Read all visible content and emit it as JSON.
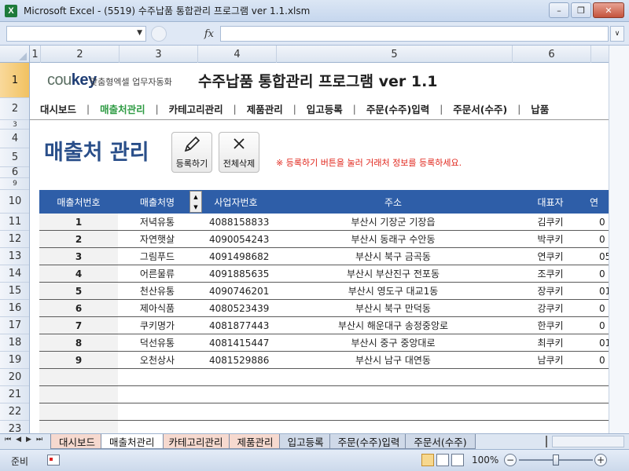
{
  "window": {
    "title": "Microsoft Excel - (5519) 수주납품 통합관리 프로그램 ver 1.1.xlsm",
    "app_icon": "X"
  },
  "formula_bar": {
    "name_box": "",
    "fx": "fx",
    "formula": ""
  },
  "columns": [
    "1",
    "2",
    "3",
    "4",
    "5",
    "6"
  ],
  "rows": [
    "1",
    "2",
    "3",
    "4",
    "5",
    "6",
    "9",
    "10",
    "11",
    "12",
    "13",
    "14",
    "15",
    "16",
    "17",
    "18",
    "19",
    "20",
    "21",
    "22",
    "23"
  ],
  "header": {
    "logo_main": "cou",
    "logo_bold": "key",
    "logo_sub": "맞춤형엑셀 업무자동화",
    "title": "수주납품 통합관리 프로그램 ver 1.1"
  },
  "menu": [
    "대시보드",
    "매출처관리",
    "카테고리관리",
    "제품관리",
    "입고등록",
    "주문(수주)입력",
    "주문서(수주)",
    "납품"
  ],
  "active_menu": "매출처관리",
  "section": {
    "title": "매출처 관리",
    "register_label": "등록하기",
    "delete_all_label": "전체삭제",
    "notice": "※ 등록하기 버튼을 눌러 거래처 정보를 등록하세요."
  },
  "table": {
    "headers": [
      "매출처번호",
      "매출처명",
      "사업자번호",
      "주소",
      "대표자",
      "연"
    ],
    "rows": [
      [
        "1",
        "저녁유통",
        "4088158833",
        "부산시 기장군 기장읍",
        "김쿠키",
        "0"
      ],
      [
        "2",
        "자연햇살",
        "4090054243",
        "부산시 동래구 수안동",
        "박쿠키",
        "0"
      ],
      [
        "3",
        "그림푸드",
        "4091498682",
        "부산시 북구 금곡동",
        "연쿠키",
        "05"
      ],
      [
        "4",
        "어른물류",
        "4091885635",
        "부산시 부산진구 전포동",
        "조쿠키",
        "0"
      ],
      [
        "5",
        "천산유통",
        "4090746201",
        "부산시 영도구 대교1동",
        "장쿠키",
        "01"
      ],
      [
        "6",
        "제아식품",
        "4080523439",
        "부산시 북구 만덕동",
        "강쿠키",
        "0"
      ],
      [
        "7",
        "쿠키명가",
        "4081877443",
        "부산시 해운대구 송정중앙로",
        "한쿠키",
        "0"
      ],
      [
        "8",
        "덕선유통",
        "4081415447",
        "부산시 중구 중앙대로",
        "최쿠키",
        "01"
      ],
      [
        "9",
        "오천상사",
        "4081529886",
        "부산시 남구 대연동",
        "남쿠키",
        "0"
      ]
    ]
  },
  "sheet_tabs": [
    "대시보드",
    "매출처관리",
    "카테고리관리",
    "제품관리",
    "입고등록",
    "주문(수주)입력",
    "주문서(수주)"
  ],
  "active_tab": "매출처관리",
  "status": {
    "mode": "준비",
    "zoom": "100%",
    "zoom_level_percent": 100
  }
}
